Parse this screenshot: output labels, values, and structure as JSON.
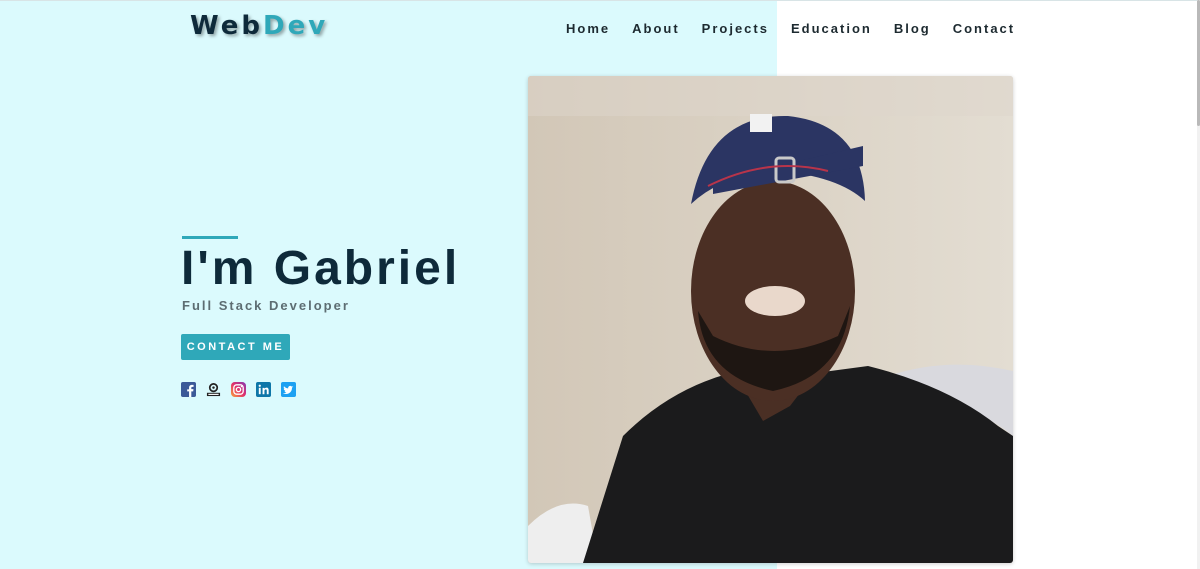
{
  "brand": {
    "part1": "Web",
    "part2": "Dev"
  },
  "nav": {
    "items": [
      {
        "label": "Home"
      },
      {
        "label": "About"
      },
      {
        "label": "Projects"
      },
      {
        "label": "Education"
      },
      {
        "label": "Blog"
      },
      {
        "label": "Contact"
      }
    ]
  },
  "hero": {
    "name": "I'm Gabriel",
    "role": "Full Stack Developer",
    "cta_label": "CONTACT ME"
  },
  "socials": [
    "facebook-icon",
    "github-icon",
    "instagram-icon",
    "linkedin-icon",
    "twitter-icon"
  ],
  "colors": {
    "accent": "#2fa8b9",
    "dark": "#0e2a3a",
    "hero_bg": "#dbfafd"
  }
}
